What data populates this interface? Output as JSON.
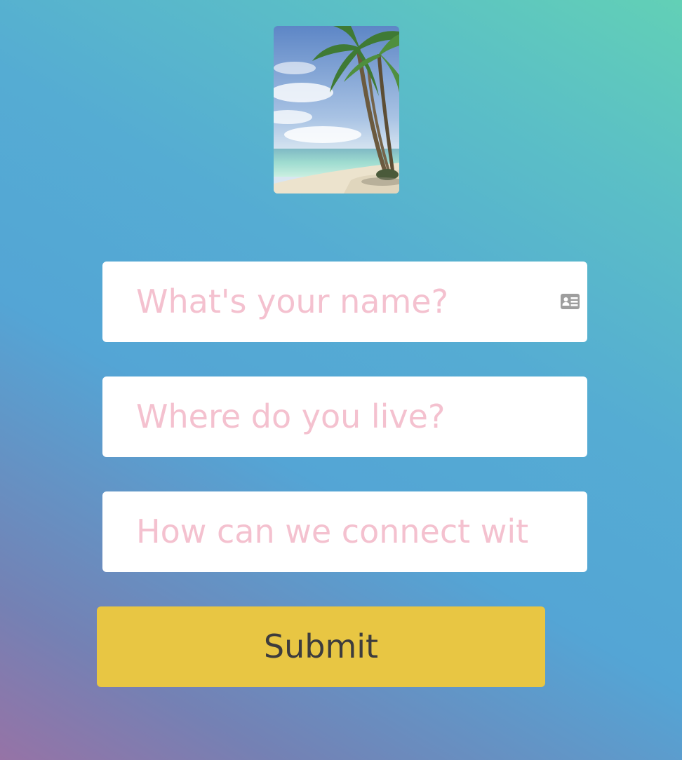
{
  "hero_image": {
    "description_icon": "palm-beach-photo"
  },
  "form": {
    "name_field": {
      "placeholder": "What's your name?",
      "icon": "contact-card-icon"
    },
    "location_field": {
      "placeholder": "Where do you live?"
    },
    "connect_field": {
      "placeholder": "How can we connect wit"
    },
    "submit_label": "Submit"
  },
  "colors": {
    "placeholder": "#f4c1cf",
    "button": "#e8c643",
    "button_text": "#3d3c3d",
    "gradient_start": "#9673a6",
    "gradient_mid": "#54a5d5",
    "gradient_end": "#62d0b6"
  }
}
